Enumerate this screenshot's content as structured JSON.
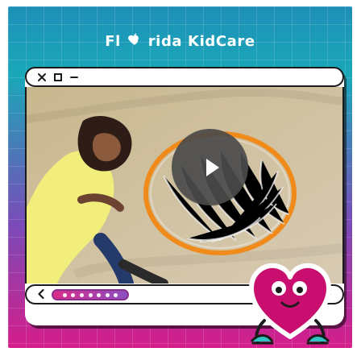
{
  "brand": {
    "text_before": "Fl",
    "text_after": "rida KidCare",
    "heart_color": "#ffffff"
  },
  "colors": {
    "gradient_top": "#1e8fb7",
    "gradient_mid": "#7a4bb7",
    "gradient_bottom": "#d51d8a",
    "frame_border": "#1b1b1b",
    "video_bg": "#cdbd93",
    "play_bg": "#4b4b4b"
  },
  "icons": {
    "close": "close-icon",
    "maximize": "square-icon",
    "minimize": "minus-icon",
    "play": "play-icon",
    "prev": "chevron-left-icon",
    "next": "chevron-right-icon",
    "mascot": "heart-mascot-icon"
  },
  "carousel": {
    "dot_count": 7
  }
}
